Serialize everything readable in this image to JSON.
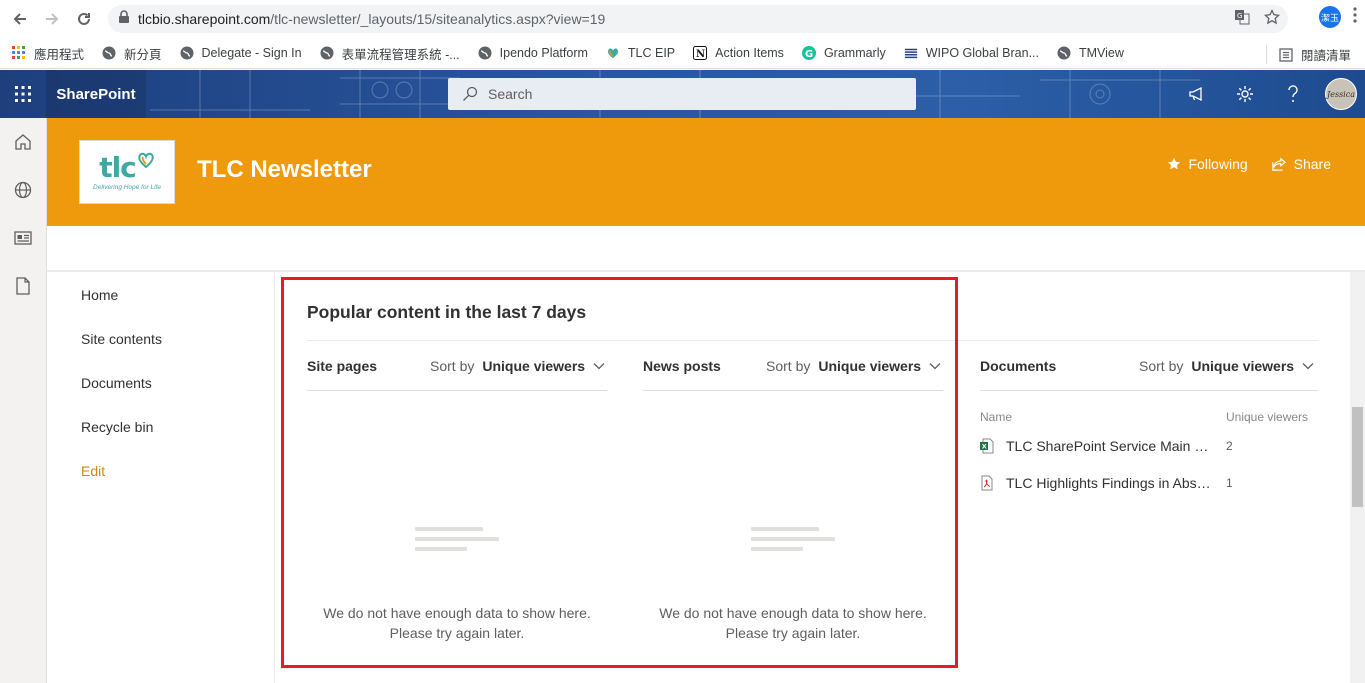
{
  "browser": {
    "url_host": "tlcbio.sharepoint.com",
    "url_path": "/tlc-newsletter/_layouts/15/siteanalytics.aspx?view=19",
    "profile_label": "潔玉"
  },
  "bookmarks": [
    {
      "label": "應用程式",
      "icon": "apps-icon"
    },
    {
      "label": "新分頁",
      "icon": "globe-icon"
    },
    {
      "label": "Delegate - Sign In",
      "icon": "globe-icon"
    },
    {
      "label": "表單流程管理系統 -...",
      "icon": "globe-icon"
    },
    {
      "label": "Ipendo Platform",
      "icon": "globe-icon"
    },
    {
      "label": "TLC EIP",
      "icon": "tlc-icon"
    },
    {
      "label": "Action Items",
      "icon": "notion-icon"
    },
    {
      "label": "Grammarly",
      "icon": "grammarly-icon"
    },
    {
      "label": "WIPO Global Bran...",
      "icon": "wipo-icon"
    },
    {
      "label": "TMView",
      "icon": "globe-icon"
    }
  ],
  "reading_list": "閱讀清單",
  "suite": {
    "app_name": "SharePoint",
    "search_placeholder": "Search",
    "avatar_text": "Jessica"
  },
  "site": {
    "logo_text": "tlc",
    "logo_tagline": "Delivering Hope for Life",
    "title": "TLC Newsletter",
    "following_label": "Following",
    "share_label": "Share"
  },
  "nav": {
    "items": [
      "Home",
      "Site contents",
      "Documents",
      "Recycle bin"
    ],
    "edit_label": "Edit"
  },
  "popular": {
    "title": "Popular content in the last 7 days",
    "sort_by_label": "Sort by",
    "sort_value": "Unique viewers",
    "site_pages_title": "Site pages",
    "news_posts_title": "News posts",
    "documents_title": "Documents",
    "empty_line1": "We do not have enough data to show here.",
    "empty_line2": "Please try again later.",
    "doc_col_name": "Name",
    "doc_col_viewers": "Unique viewers",
    "documents": [
      {
        "name": "TLC SharePoint Service Main Site Survey",
        "viewers": "2",
        "type": "excel"
      },
      {
        "name": "TLC Highlights Findings in Abstracts",
        "viewers": "1",
        "type": "pdf"
      }
    ]
  },
  "colors": {
    "header_orange": "#ef9a0c",
    "highlight_red": "#e21d29",
    "suite_blue": "#27559e"
  }
}
